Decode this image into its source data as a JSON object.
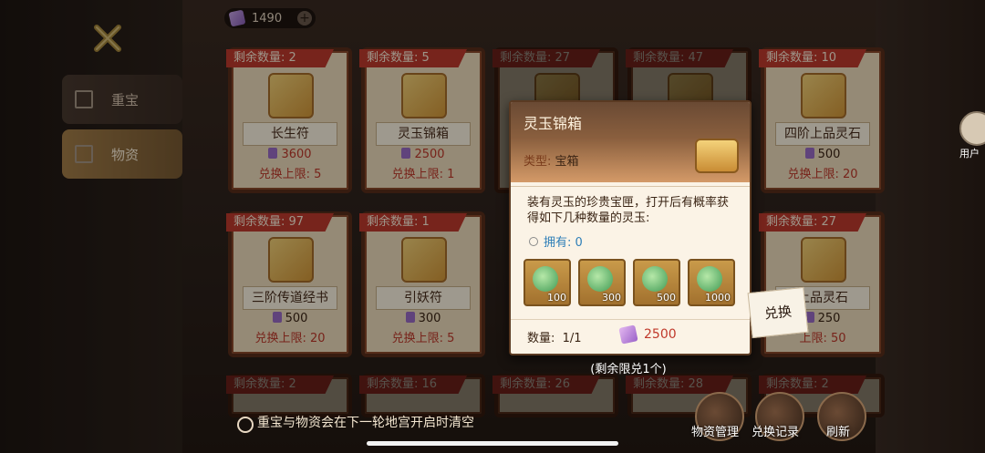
{
  "currency": {
    "amount": "1490",
    "plus": "+"
  },
  "tabs": [
    {
      "label": "重宝"
    },
    {
      "label": "物资"
    }
  ],
  "cards_row1": [
    {
      "remaining": "剩余数量: 2",
      "name": "长生符",
      "price": "3600",
      "limit": "兑换上限: 5"
    },
    {
      "remaining": "剩余数量: 5",
      "name": "灵玉锦箱",
      "price": "2500",
      "limit": "兑换上限: 1"
    },
    {
      "remaining": "剩余数量: 27"
    },
    {
      "remaining": "剩余数量: 47"
    },
    {
      "remaining": "剩余数量: 10",
      "name": "四阶上品灵石",
      "price": "500",
      "limit": "兑换上限: 20"
    }
  ],
  "cards_row2": [
    {
      "remaining": "剩余数量: 97",
      "name": "三阶传道经书",
      "price": "500",
      "limit": "兑换上限: 20"
    },
    {
      "remaining": "剩余数量: 1",
      "name": "引妖符",
      "price": "300",
      "limit": "兑换上限: 5"
    },
    {
      "remaining": "剩余数量: 27",
      "name": "上品灵石",
      "price": "250",
      "limit": "上限: 50"
    }
  ],
  "cards_row3": [
    {
      "remaining": "剩余数量: 2"
    },
    {
      "remaining": "剩余数量: 16"
    },
    {
      "remaining": "剩余数量: 26"
    },
    {
      "remaining": "剩余数量: 28"
    },
    {
      "remaining": "剩余数量: 2"
    }
  ],
  "popup": {
    "title": "灵玉锦箱",
    "type_label": "类型:",
    "type_value": "宝箱",
    "description": "装有灵玉的珍贵宝匣，打开后有概率获得如下几种数量的灵玉:",
    "owned_label": "拥有:",
    "owned_value": "0",
    "rewards": [
      "100",
      "300",
      "500",
      "1000"
    ],
    "quantity_label": "数量:",
    "quantity_value": "1/1",
    "cost": "2500"
  },
  "redeem_button": "兑换",
  "remain_note": "(剩余限兑1个)",
  "bottom_note": "重宝与物资会在下一轮地宫开启时清空",
  "bottom_buttons": [
    "物资管理",
    "兑换记录",
    "刷新"
  ],
  "side": {
    "user_label": "用户"
  }
}
